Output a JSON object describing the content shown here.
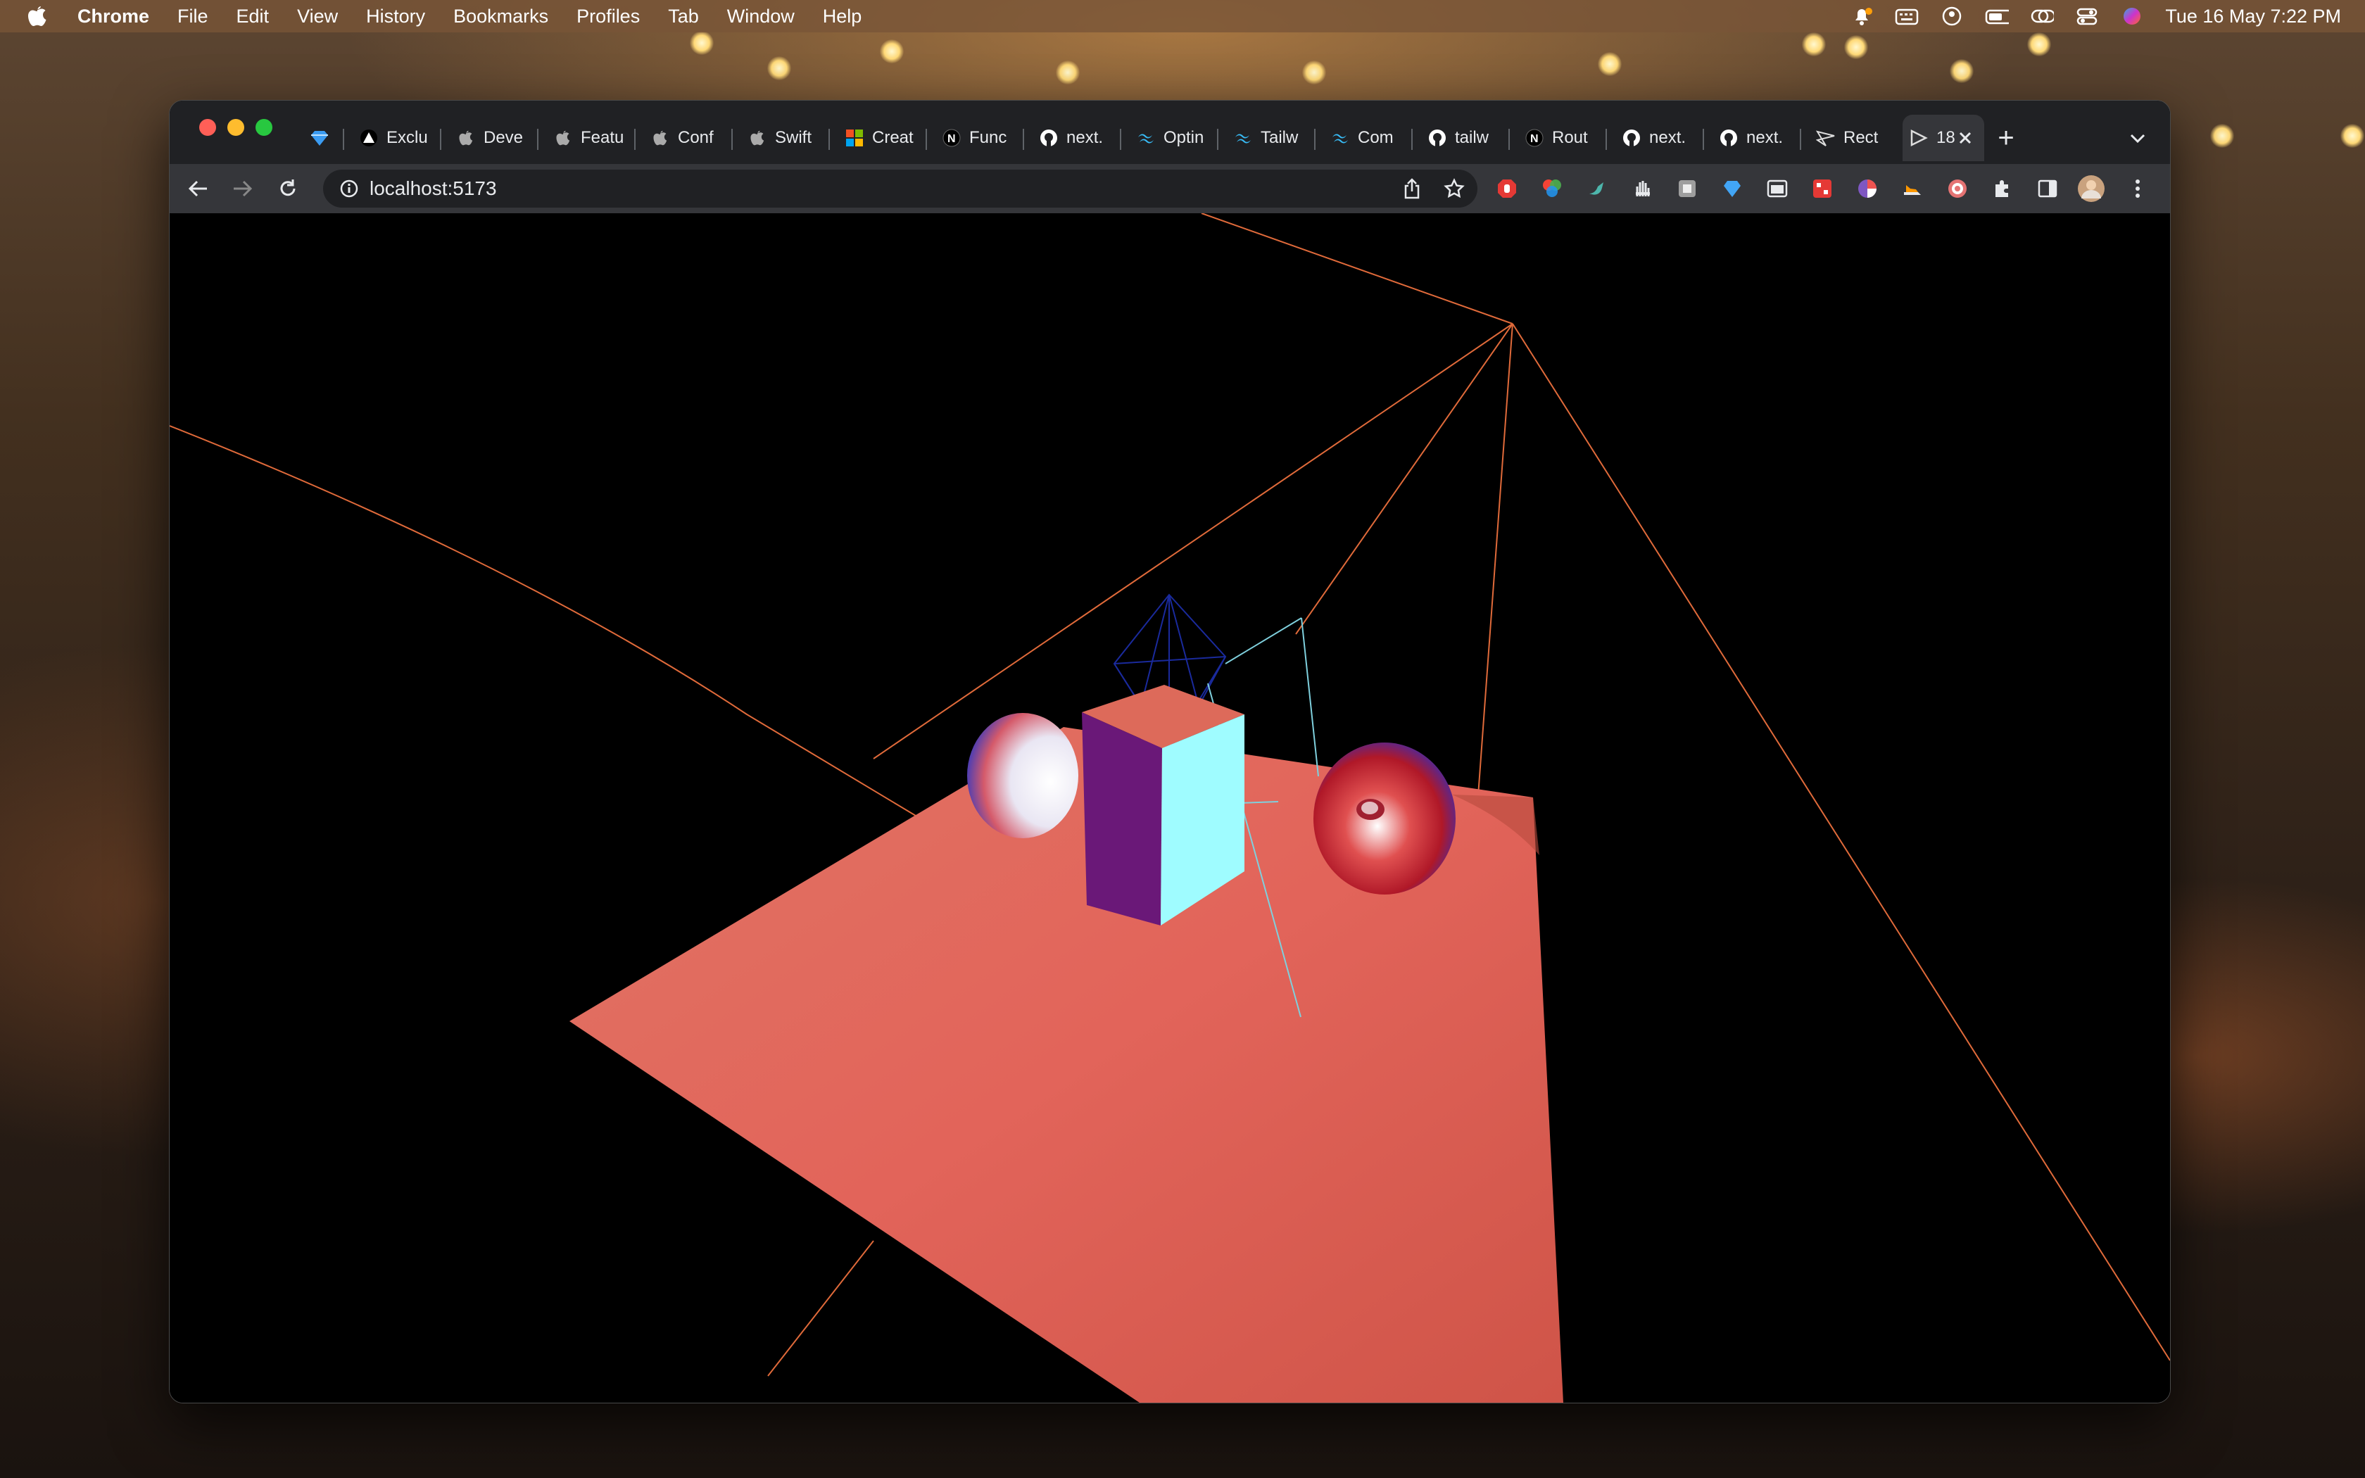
{
  "menubar": {
    "app_name": "Chrome",
    "items": [
      "File",
      "Edit",
      "View",
      "History",
      "Bookmarks",
      "Profiles",
      "Tab",
      "Window",
      "Help"
    ],
    "clock": "Tue 16 May  7:22 PM"
  },
  "browser": {
    "tabs": [
      {
        "title": "",
        "icon": "diamond-icon"
      },
      {
        "title": "Exclu",
        "icon": "triangle-icon"
      },
      {
        "title": "Deve",
        "icon": "apple-icon"
      },
      {
        "title": "Featu",
        "icon": "apple-icon"
      },
      {
        "title": "Conf",
        "icon": "apple-icon"
      },
      {
        "title": "Swift",
        "icon": "apple-icon"
      },
      {
        "title": "Creat",
        "icon": "microsoft-icon"
      },
      {
        "title": "Func",
        "icon": "nextjs-icon"
      },
      {
        "title": "next.",
        "icon": "github-icon"
      },
      {
        "title": "Optin",
        "icon": "tailwind-icon"
      },
      {
        "title": "Tailw",
        "icon": "tailwind-icon"
      },
      {
        "title": "Com",
        "icon": "tailwind-icon"
      },
      {
        "title": "tailw",
        "icon": "github-icon"
      },
      {
        "title": "Rout",
        "icon": "nextjs-icon"
      },
      {
        "title": "next.",
        "icon": "github-icon"
      },
      {
        "title": "next.",
        "icon": "github-icon"
      },
      {
        "title": "Rect",
        "icon": "react-three-icon"
      },
      {
        "title": "18",
        "icon": "vite-icon",
        "active": true
      }
    ],
    "new_tab_label": "+",
    "url": "localhost:5173"
  },
  "scene": {
    "plane_color": "#e2645a",
    "sphere_colors": [
      "#ffffff",
      "#e04040",
      "#2030d0"
    ],
    "cube_front_color": "#6a1878",
    "cube_side_color": "#9ffcff",
    "line_color": "#e06a3a"
  },
  "colors": {
    "close": "#ff5f57",
    "minimize": "#febc2e",
    "maximize": "#28c840"
  }
}
